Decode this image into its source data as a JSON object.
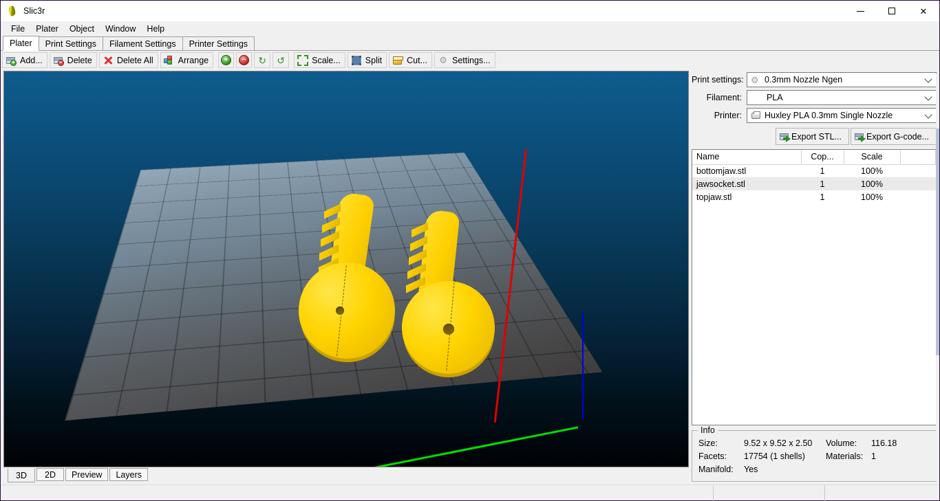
{
  "window": {
    "title": "Slic3r",
    "app_icon": "slic3r-logo-icon",
    "minimize": "minimize-icon",
    "maximize": "maximize-icon",
    "close": "close-icon"
  },
  "menubar": {
    "items": [
      "File",
      "Plater",
      "Object",
      "Window",
      "Help"
    ]
  },
  "tabs": {
    "items": [
      "Plater",
      "Print Settings",
      "Filament Settings",
      "Printer Settings"
    ],
    "active": "Plater"
  },
  "toolbar": {
    "buttons": [
      {
        "label": "Add...",
        "icon": "add-object-icon"
      },
      {
        "label": "Delete",
        "icon": "delete-object-icon"
      },
      {
        "label": "Delete All",
        "icon": "delete-all-icon"
      },
      {
        "label": "Arrange",
        "icon": "arrange-icon"
      }
    ],
    "icon_buttons": [
      {
        "label": "+",
        "icon": "increase-copies-icon"
      },
      {
        "label": "−",
        "icon": "decrease-copies-icon"
      },
      {
        "label": "",
        "icon": "rotate-ccw-icon"
      },
      {
        "label": "",
        "icon": "rotate-cw-icon"
      }
    ],
    "tool_buttons": [
      {
        "label": "Scale...",
        "icon": "scale-icon"
      },
      {
        "label": "Split",
        "icon": "split-icon"
      },
      {
        "label": "Cut...",
        "icon": "cut-icon"
      },
      {
        "label": "Settings...",
        "icon": "settings-gear-icon"
      }
    ]
  },
  "presets": {
    "print_settings": {
      "label": "Print settings:",
      "value": "0.3mm Nozzle Ngen",
      "icon": "gear-icon"
    },
    "filament": {
      "label": "Filament:",
      "value": "PLA",
      "icon": "none"
    },
    "printer": {
      "label": "Printer:",
      "value": "Huxley PLA 0.3mm Single Nozzle",
      "icon": "printer-icon"
    }
  },
  "export": {
    "stl": "Export STL...",
    "gcode": "Export G-code..."
  },
  "objects": {
    "columns": [
      "Name",
      "Cop...",
      "Scale",
      ""
    ],
    "rows": [
      {
        "name": "bottomjaw.stl",
        "copies": "1",
        "scale": "100%",
        "selected": false
      },
      {
        "name": "jawsocket.stl",
        "copies": "1",
        "scale": "100%",
        "selected": true
      },
      {
        "name": "topjaw.stl",
        "copies": "1",
        "scale": "100%",
        "selected": false
      }
    ]
  },
  "info": {
    "legend": "Info",
    "size_label": "Size:",
    "size_value": "9.52 x 9.52 x 2.50",
    "volume_label": "Volume:",
    "volume_value": "116.18",
    "facets_label": "Facets:",
    "facets_value": "17754 (1 shells)",
    "materials_label": "Materials:",
    "materials_value": "1",
    "manifold_label": "Manifold:",
    "manifold_value": "Yes"
  },
  "viewmodes": {
    "items": [
      "3D",
      "2D",
      "Preview",
      "Layers"
    ],
    "active": "3D"
  },
  "viewport": {
    "bg_top_color": "#0f5c8c",
    "bg_bottom_color": "#000205",
    "plate_color": "#8e9aa4",
    "model_color": "#ffd400",
    "axis_x_color": "#e00000",
    "axis_y_color": "#00e000",
    "axis_z_color": "#0000e8",
    "marker_color": "#19c219"
  }
}
